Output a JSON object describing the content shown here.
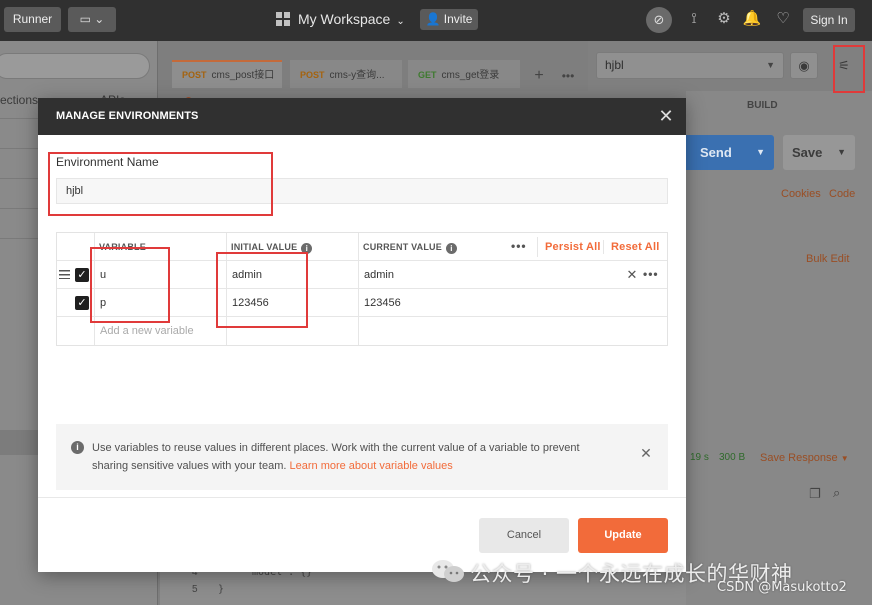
{
  "topbar": {
    "runner_label": "Runner",
    "workspace_label": "My Workspace",
    "invite_label": "Invite",
    "signin_label": "Sign In"
  },
  "sidebar": {
    "tab_collections": "ections",
    "tab_apis": "APIs"
  },
  "request_tabs": [
    {
      "method": "POST",
      "name": "cms_post接口",
      "unsaved": true
    },
    {
      "method": "POST",
      "name": "cms-y查询..."
    },
    {
      "method": "GET",
      "name": "cms_get登录"
    }
  ],
  "environment_selector": {
    "selected": "hjbl"
  },
  "request_bar": {
    "build_label": "BUILD",
    "send_label": "Send",
    "save_label": "Save",
    "cookies_label": "Cookies",
    "code_label": "Code",
    "bulk_edit_label": "Bulk Edit",
    "status_time": "19 s",
    "status_size": "300 B",
    "save_response_label": "Save Response"
  },
  "modal": {
    "title": "MANAGE ENVIRONMENTS",
    "env_name_label": "Environment Name",
    "env_name_value": "hjbl",
    "columns": {
      "variable": "VARIABLE",
      "initial_value": "INITIAL VALUE",
      "current_value": "CURRENT VALUE"
    },
    "persist_all_label": "Persist All",
    "reset_all_label": "Reset All",
    "variables": [
      {
        "enabled": true,
        "key": "u",
        "initial": "admin",
        "current": "admin"
      },
      {
        "enabled": true,
        "key": "p",
        "initial": "123456",
        "current": "123456"
      }
    ],
    "add_variable_placeholder": "Add a new variable",
    "info_text": "Use variables to reuse values in different places. Work with the current value of a variable to prevent sharing sensitive values with your team.",
    "info_link": "Learn more about variable values",
    "cancel_label": "Cancel",
    "update_label": "Update"
  },
  "code_snippet": {
    "line4_no": "4",
    "line4": "\"model\": {}",
    "line5_no": "5",
    "line5": "}"
  },
  "watermark": {
    "wechat_text": "公众号 · 一个永远在成长的华财神",
    "csdn_text": "CSDN @Masukotto2"
  },
  "colors": {
    "accent": "#f26b3a",
    "header_dark": "#303030",
    "annotation_red": "#e03a3a",
    "send_blue": "#3a70b1"
  }
}
